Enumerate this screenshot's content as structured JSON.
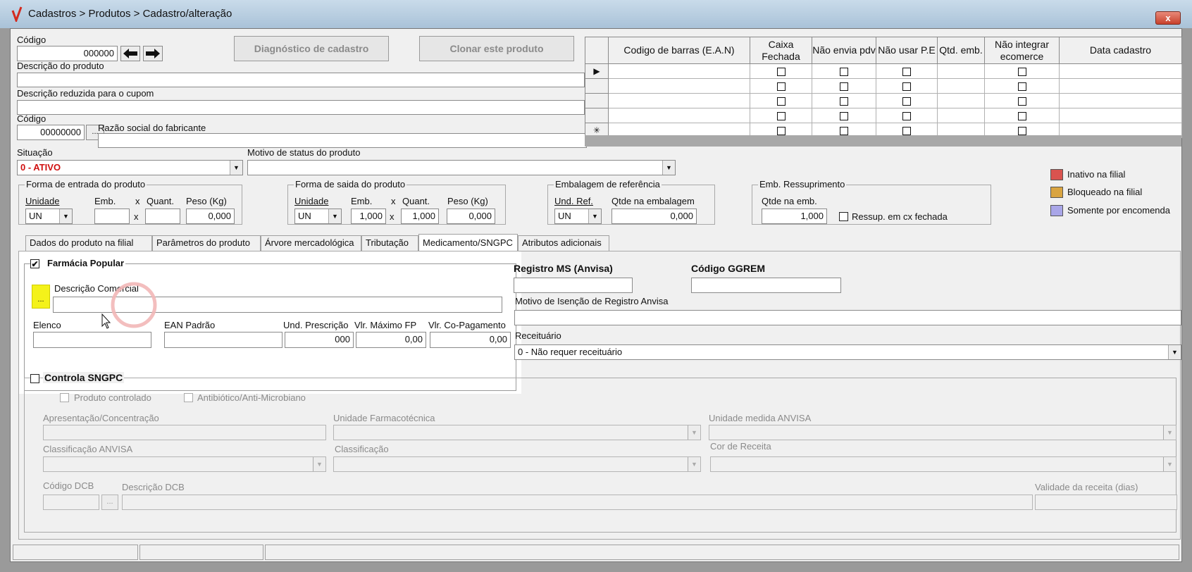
{
  "window": {
    "title": "Cadastros > Produtos > Cadastro/alteração",
    "close_label": "x"
  },
  "header": {
    "codigo_label": "Código",
    "codigo_value": "000000",
    "diagnostico_label": "Diagnóstico de cadastro",
    "clonar_label": "Clonar este produto",
    "descricao_label": "Descrição  do produto",
    "descricao_reduzida_label": "Descrição reduzida para o cupom",
    "fabricante_codigo_label": "Código",
    "fabricante_codigo_value": "00000000",
    "fabricante_lookup_label": "...",
    "razao_social_label": "Razão social do fabricante",
    "situacao_label": "Situação",
    "situacao_value": "0 - ATIVO",
    "motivo_status_label": "Motivo de status do produto",
    "motivo_status_value": ""
  },
  "barcode_grid": {
    "columns": [
      "Codigo de barras (E.A.N)",
      "Caixa Fechada",
      "Não envia pdv",
      "Não usar P.E",
      "Qtd. emb.",
      "Não integrar ecomerce",
      "Data cadastro"
    ],
    "row_indicators": [
      "▶",
      "",
      "",
      "",
      "✳"
    ]
  },
  "entrada": {
    "title": "Forma de entrada do produto",
    "unidade_label": "Unidade",
    "unidade_value": "UN",
    "emb_label": "Emb.",
    "x_label": "x",
    "quant_label": "Quant.",
    "peso_label": "Peso (Kg)",
    "peso_value": "0,000"
  },
  "saida": {
    "title": "Forma de saida do produto",
    "unidade_label": "Unidade",
    "unidade_value": "UN",
    "emb_label": "Emb.",
    "emb_value": "1,000",
    "x_label": "x",
    "quant_label": "Quant.",
    "quant_value": "1,000",
    "peso_label": "Peso (Kg)",
    "peso_value": "0,000"
  },
  "embalagem": {
    "title": "Embalagem de referência",
    "und_ref_label": "Und. Ref.",
    "und_ref_value": "UN",
    "qtde_label": "Qtde na embalagem",
    "qtde_value": "0,000"
  },
  "ressuprimento": {
    "title": "Emb. Ressuprimento",
    "qtde_label": "Qtde na emb.",
    "qtde_value": "1,000",
    "cx_fechada_label": "Ressup. em cx fechada"
  },
  "legend": [
    {
      "label": "Inativo na filial",
      "color": "#d9534f"
    },
    {
      "label": "Bloqueado na filial",
      "color": "#d9a441"
    },
    {
      "label": "Somente por encomenda",
      "color": "#a9a6e8"
    }
  ],
  "tabs": [
    "Dados do produto na filial",
    "Parâmetros do produto",
    "Árvore mercadológica",
    "Tributação",
    "Medicamento/SNGPC",
    "Atributos adicionais"
  ],
  "farmacia_popular": {
    "title": "Farmácia Popular",
    "checked": "✔",
    "lookup_label": "...",
    "descricao_label": "Descrição Comercial",
    "elenco_label": "Elenco",
    "ean_label": "EAN Padrão",
    "und_prescricao_label": "Und. Prescrição",
    "und_prescricao_value": "000",
    "vlr_maximo_label": "Vlr. Máximo FP",
    "vlr_maximo_value": "0,00",
    "vlr_copagamento_label": "Vlr. Co-Pagamento",
    "vlr_copagamento_value": "0,00"
  },
  "registro": {
    "registro_ms_label": "Registro MS (Anvisa)",
    "codigo_ggrem_label": "Código GGREM",
    "motivo_isencao_label": "Motivo de Isenção de Registro Anvisa",
    "receituario_label": "Receituário",
    "receituario_value": "0 - Não requer receituário"
  },
  "sngpc": {
    "title": "Controla SNGPC",
    "produto_controlado_label": "Produto controlado",
    "antibiotico_label": "Antibiótico/Anti-Microbiano",
    "apresentacao_label": "Apresentação/Concentração",
    "unidade_farmacotecnica_label": "Unidade Farmacotécnica",
    "unidade_anvisa_label": "Unidade medida ANVISA",
    "classificacao_anvisa_label": "Classificação ANVISA",
    "classificacao_label": "Classificação",
    "cor_receita_label": "Cor de  Receita",
    "codigo_dcb_label": "Código DCB",
    "dcb_lookup_label": "...",
    "descricao_dcb_label": "Descrição DCB",
    "validade_label": "Validade da receita (dias)"
  }
}
